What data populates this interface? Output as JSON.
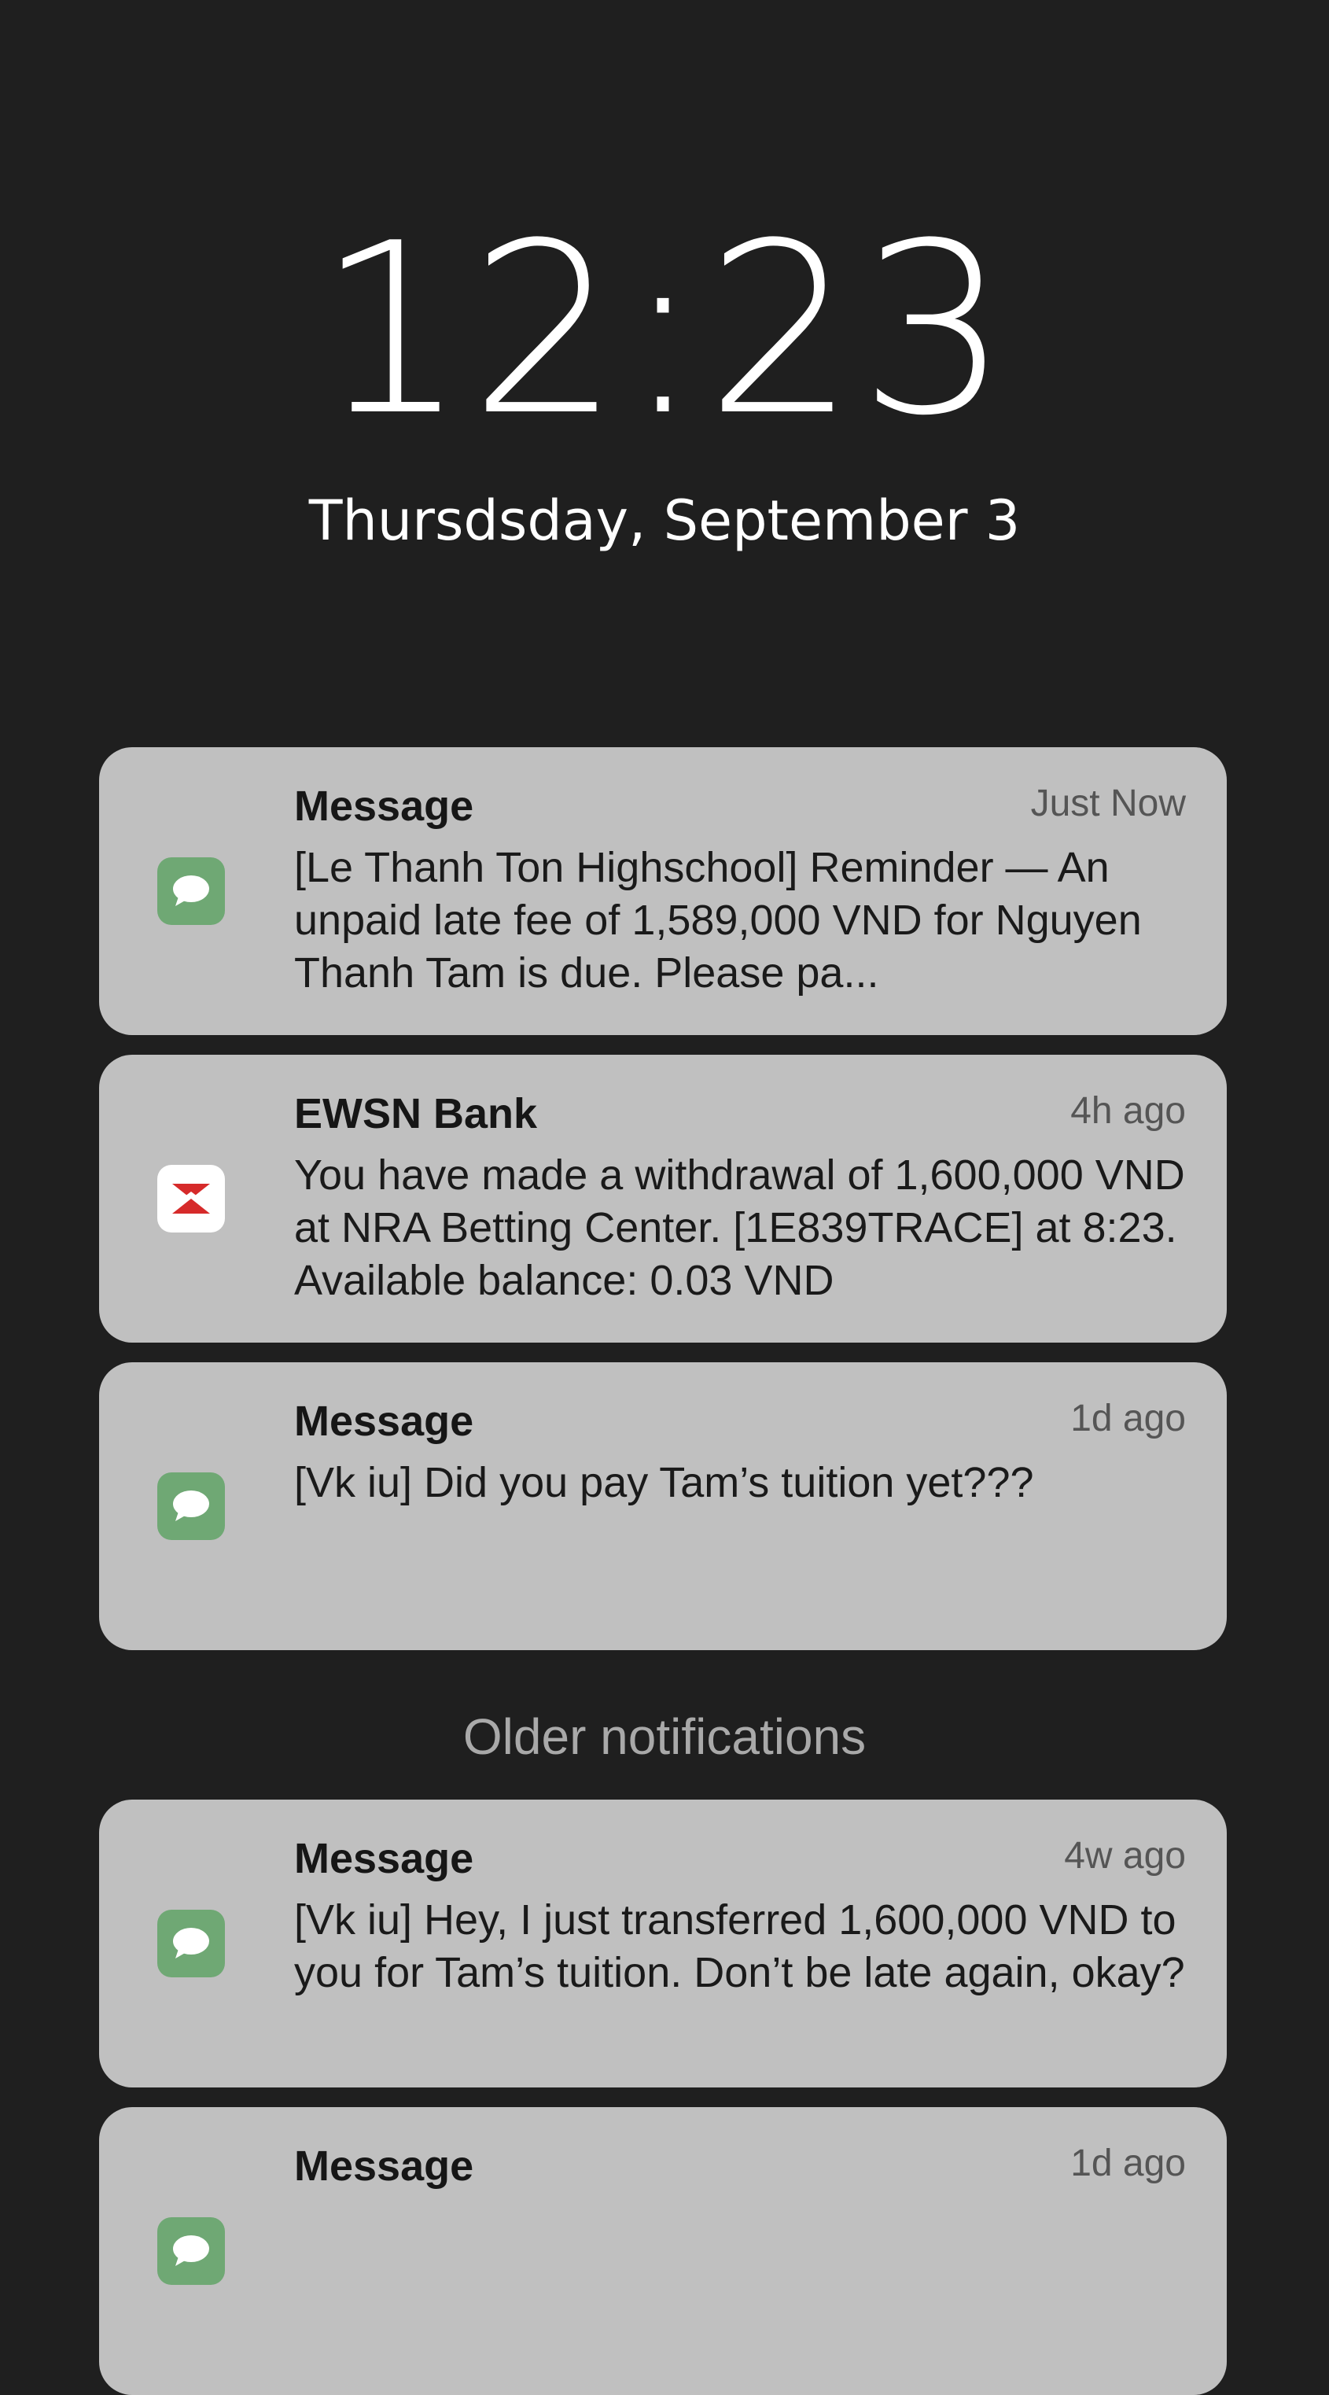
{
  "lockscreen": {
    "time": "12:23",
    "date": "Thursdsday, September 3"
  },
  "colors": {
    "background": "#1f1f1f",
    "card": "#c0c0c0",
    "message_icon": "#6fa874",
    "bank_icon_accent": "#d62a2a"
  },
  "notifications": [
    {
      "app": "Message",
      "icon": "chat-bubble-icon",
      "time": "Just Now",
      "body": "[Le Thanh Ton Highschool] Reminder — An unpaid late fee of 1,589,000 VND for Nguyen Thanh Tam is due. Please pa..."
    },
    {
      "app": "EWSN Bank",
      "icon": "bank-logo-icon",
      "time": "4h ago",
      "body": "You have made a withdrawal of 1,600,000 VND at NRA Betting Center. [1E839TRACE] at 8:23. Available balance: 0.03 VND"
    },
    {
      "app": "Message",
      "icon": "chat-bubble-icon",
      "time": "1d ago",
      "body": "[Vk iu] Did you pay Tam’s tuition yet???"
    }
  ],
  "older_section": {
    "label": "Older notifications"
  },
  "older_notifications": [
    {
      "app": "Message",
      "icon": "chat-bubble-icon",
      "time": "4w ago",
      "body": "[Vk iu] Hey, I just transferred 1,600,000 VND to you for Tam’s tuition. Don’t be late again, okay?"
    },
    {
      "app": "Message",
      "icon": "chat-bubble-icon",
      "time": "1d ago",
      "body": ""
    }
  ]
}
